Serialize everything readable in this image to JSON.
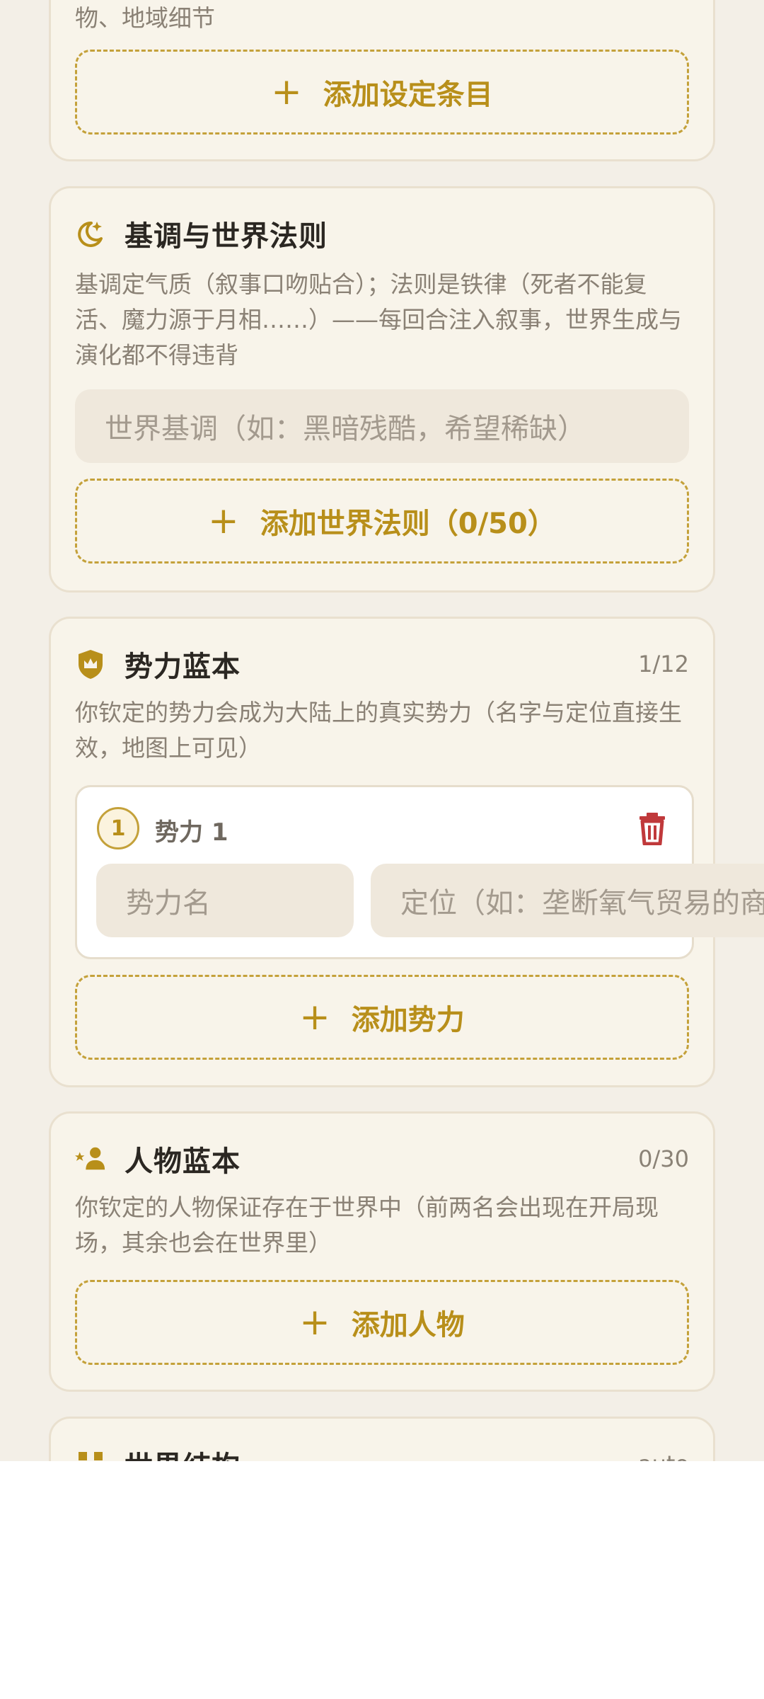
{
  "settings_card": {
    "desc_tail": "物、地域细节",
    "add_label": "添加设定条目"
  },
  "tone_card": {
    "icon": "moon-stars-icon",
    "title": "基调与世界法则",
    "desc": "基调定气质（叙事口吻贴合）；法则是铁律（死者不能复活、魔力源于月相……）——每回合注入叙事，世界生成与演化都不得违背",
    "tone_placeholder": "世界基调（如：黑暗残酷，希望稀缺）",
    "add_label": "添加世界法则（0/50）"
  },
  "faction_card": {
    "icon": "shield-crown-icon",
    "title": "势力蓝本",
    "count": "1/12",
    "desc": "你钦定的势力会成为大陆上的真实势力（名字与定位直接生效，地图上可见）",
    "items": [
      {
        "number": "1",
        "label": "势力 1",
        "name_placeholder": "势力名",
        "role_placeholder": "定位（如：垄断氧气贸易的商会）"
      }
    ],
    "add_label": "添加势力"
  },
  "character_card": {
    "icon": "person-star-icon",
    "title": "人物蓝本",
    "count": "0/30",
    "desc": "你钦定的人物保证存在于世界中（前两名会出现在开局现场，其余也会在世界里）",
    "add_label": "添加人物"
  },
  "structure_card": {
    "icon": "structure-icon",
    "title": "世界结构",
    "count": "auto"
  },
  "colors": {
    "accent": "#b88f1a",
    "danger": "#c0393b",
    "card_bg": "#f8f4ea",
    "page_bg": "#f3efe7"
  }
}
